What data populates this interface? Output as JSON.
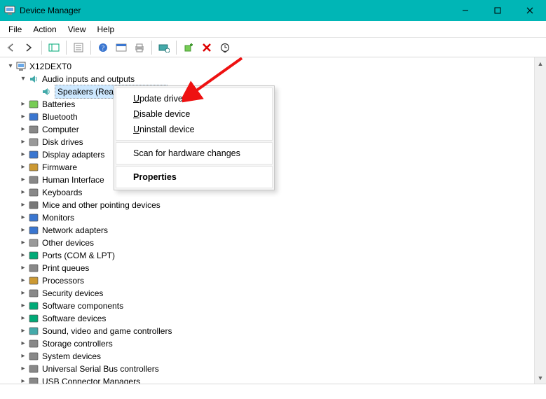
{
  "window": {
    "title": "Device Manager"
  },
  "menubar": {
    "file": "File",
    "action": "Action",
    "view": "View",
    "help": "Help"
  },
  "toolbar_icons": [
    "back-icon",
    "forward-icon",
    "show-hide-tree-icon",
    "properties-icon",
    "help-icon",
    "action-center-icon",
    "print-icon",
    "remote-icon",
    "add-legacy-icon",
    "uninstall-icon",
    "scan-icon"
  ],
  "tree": {
    "root": "X12DEXT0",
    "audio_category": "Audio inputs and outputs",
    "selected_device": "Speakers (Realtek(R) Audio)",
    "categories": [
      "Batteries",
      "Bluetooth",
      "Computer",
      "Disk drives",
      "Display adapters",
      "Firmware",
      "Human Interface",
      "Keyboards",
      "Mice and other pointing devices",
      "Monitors",
      "Network adapters",
      "Other devices",
      "Ports (COM & LPT)",
      "Print queues",
      "Processors",
      "Security devices",
      "Software components",
      "Software devices",
      "Sound, video and game controllers",
      "Storage controllers",
      "System devices",
      "Universal Serial Bus controllers",
      "USB Connector Managers"
    ]
  },
  "context_menu": {
    "update_driver": "Update driver",
    "disable_device": "Disable device",
    "uninstall_device": "Uninstall device",
    "scan_hardware": "Scan for hardware changes",
    "properties": "Properties"
  }
}
